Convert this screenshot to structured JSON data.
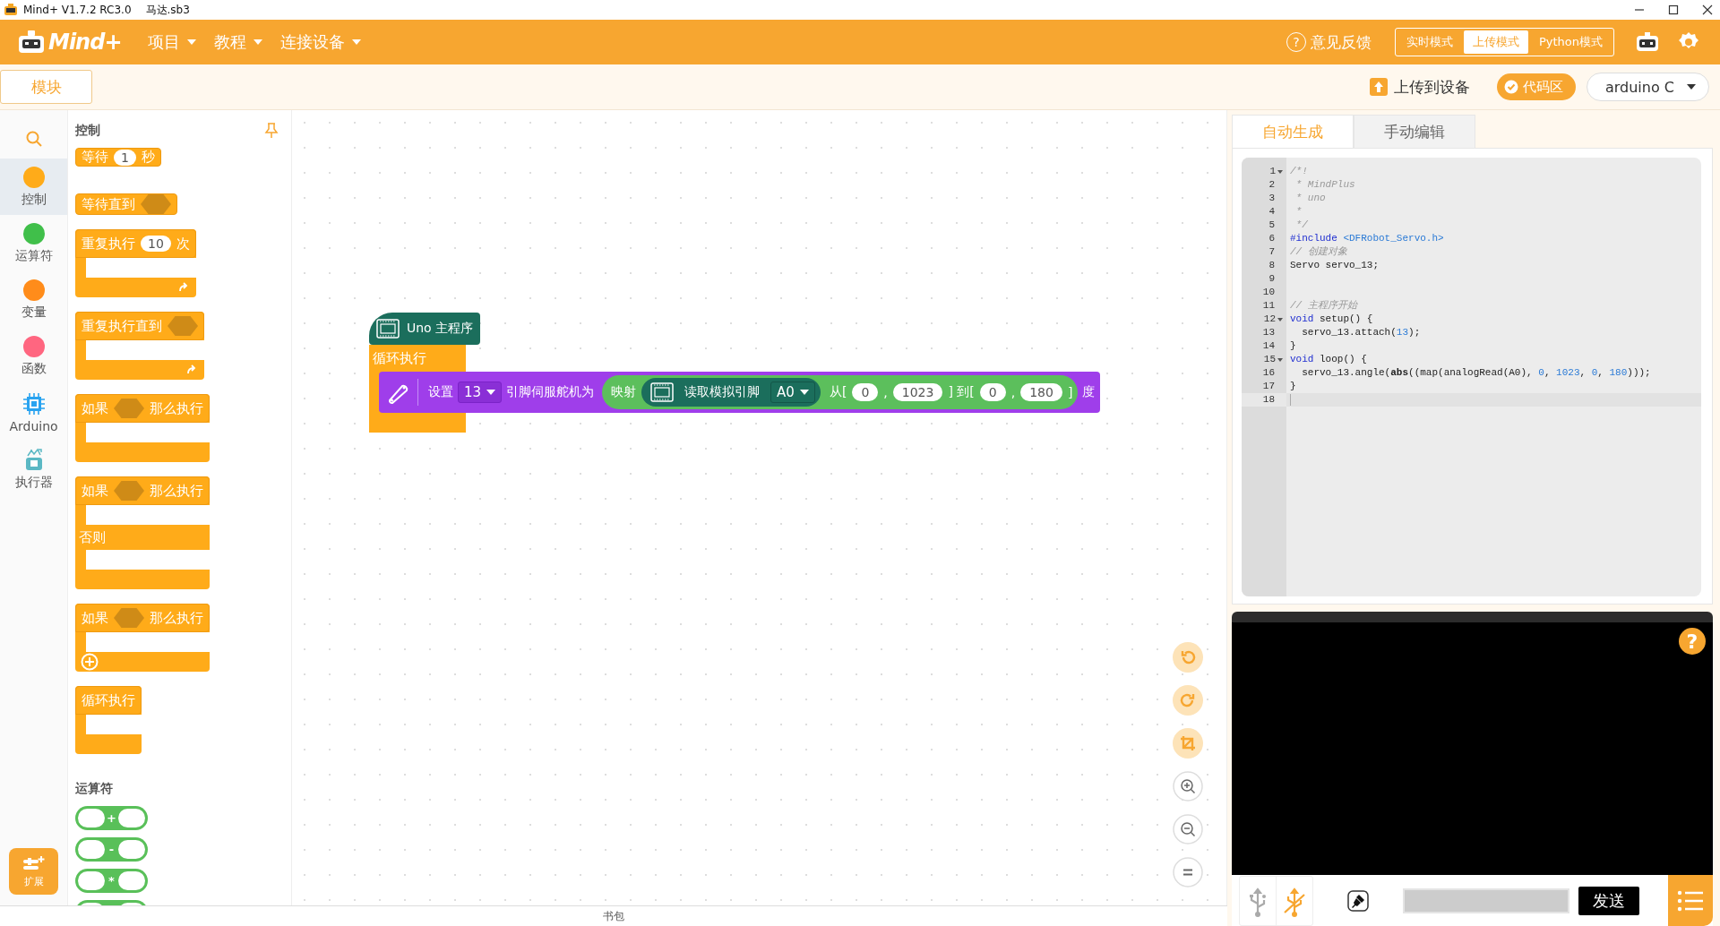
{
  "title_bar": {
    "app": "Mind+ V1.7.2 RC3.0",
    "file": "马达.sb3"
  },
  "menu_bar": {
    "logo": "Mind+",
    "menus": [
      {
        "label": "项目"
      },
      {
        "label": "教程"
      },
      {
        "label": "连接设备"
      }
    ],
    "help_mark": "?",
    "feedback": "意见反馈",
    "modes": [
      {
        "label": "实时模式",
        "selected": false
      },
      {
        "label": "上传模式",
        "selected": true
      },
      {
        "label": "Python模式",
        "selected": false
      }
    ]
  },
  "toolbar": {
    "tab": "模块",
    "upload": "上传到设备",
    "code_toggle": {
      "label": "代码区",
      "on": true
    },
    "language": "arduino C"
  },
  "categories": [
    {
      "label": "控制",
      "kind": "dot",
      "color": "#ffab19",
      "selected": true
    },
    {
      "label": "运算符",
      "kind": "dot",
      "color": "#40bf4a",
      "selected": false
    },
    {
      "label": "变量",
      "kind": "dot",
      "color": "#ff8c1a",
      "selected": false
    },
    {
      "label": "函数",
      "kind": "dot",
      "color": "#ff6680",
      "selected": false
    },
    {
      "label": "Arduino",
      "kind": "chip",
      "selected": false
    },
    {
      "label": "执行器",
      "kind": "actuator",
      "selected": false
    }
  ],
  "extension": "扩展",
  "palette": [
    {
      "heading": "控制",
      "blocks": [
        {
          "kind": "stack",
          "parts": [
            {
              "kind": "text",
              "text": "等待"
            },
            {
              "kind": "number",
              "text": "1"
            },
            {
              "kind": "text",
              "text": "秒"
            }
          ]
        },
        {
          "kind": "stack",
          "parts": [
            {
              "kind": "text",
              "text": "等待直到"
            },
            {
              "kind": "bool"
            }
          ]
        },
        {
          "kind": "loop",
          "parts": [
            {
              "kind": "text",
              "text": "重复执行"
            },
            {
              "kind": "number",
              "text": "10"
            },
            {
              "kind": "text",
              "text": "次"
            }
          ]
        },
        {
          "kind": "loop",
          "parts": [
            {
              "kind": "text",
              "text": "重复执行直到"
            },
            {
              "kind": "bool"
            }
          ]
        },
        {
          "kind": "if",
          "parts": [
            {
              "kind": "text",
              "text": "如果"
            },
            {
              "kind": "bool"
            },
            {
              "kind": "text",
              "text": "那么执行"
            }
          ]
        },
        {
          "kind": "if-else",
          "parts": [
            {
              "kind": "text",
              "text": "如果"
            },
            {
              "kind": "bool"
            },
            {
              "kind": "text",
              "text": "那么执行"
            }
          ],
          "else_label": "否则"
        },
        {
          "kind": "if-plus",
          "parts": [
            {
              "kind": "text",
              "text": "如果"
            },
            {
              "kind": "bool"
            },
            {
              "kind": "text",
              "text": "那么执行"
            }
          ]
        },
        {
          "kind": "forever",
          "parts": [
            {
              "kind": "text",
              "text": "循环执行"
            }
          ]
        }
      ]
    },
    {
      "heading": "运算符",
      "blocks": [
        {
          "kind": "operator",
          "op": "+"
        },
        {
          "kind": "operator",
          "op": "-"
        },
        {
          "kind": "operator",
          "op": "*"
        },
        {
          "kind": "operator"
        }
      ]
    }
  ],
  "script": {
    "hat": "Uno 主程序",
    "loop": "循环执行",
    "statement": [
      {
        "kind": "text",
        "text": "设置"
      },
      {
        "kind": "dropdown",
        "text": "13"
      },
      {
        "kind": "text",
        "text": "引脚伺服舵机为"
      },
      {
        "kind": "map",
        "parts": [
          {
            "kind": "text",
            "text": "映射"
          },
          {
            "kind": "sensor",
            "parts": [
              {
                "kind": "text",
                "text": "读取模拟引脚"
              },
              {
                "kind": "dropdown",
                "text": "A0"
              }
            ]
          },
          {
            "kind": "text",
            "text": "从["
          },
          {
            "kind": "number",
            "text": "0"
          },
          {
            "kind": "text",
            "text": ","
          },
          {
            "kind": "number",
            "text": "1023"
          },
          {
            "kind": "text",
            "text": "] 到["
          },
          {
            "kind": "number",
            "text": "0"
          },
          {
            "kind": "text",
            "text": ","
          },
          {
            "kind": "number",
            "text": "180"
          },
          {
            "kind": "text",
            "text": "]"
          }
        ]
      },
      {
        "kind": "text",
        "text": "度"
      }
    ]
  },
  "code_tabs": [
    {
      "label": "自动生成",
      "selected": true
    },
    {
      "label": "手动编辑",
      "selected": false
    }
  ],
  "code": [
    {
      "number": "1",
      "foldable": true,
      "current": false,
      "tokens": [
        {
          "kind": "comment",
          "text": "/*!"
        }
      ]
    },
    {
      "number": "2",
      "foldable": false,
      "current": false,
      "tokens": [
        {
          "kind": "comment",
          "text": " * MindPlus"
        }
      ]
    },
    {
      "number": "3",
      "foldable": false,
      "current": false,
      "tokens": [
        {
          "kind": "comment",
          "text": " * uno"
        }
      ]
    },
    {
      "number": "4",
      "foldable": false,
      "current": false,
      "tokens": [
        {
          "kind": "comment",
          "text": " *"
        }
      ]
    },
    {
      "number": "5",
      "foldable": false,
      "current": false,
      "tokens": [
        {
          "kind": "comment",
          "text": " */"
        }
      ]
    },
    {
      "number": "6",
      "foldable": false,
      "current": false,
      "tokens": [
        {
          "kind": "keyword",
          "text": "#include"
        },
        {
          "kind": "string",
          "text": " <DFRobot_Servo.h>"
        }
      ]
    },
    {
      "number": "7",
      "foldable": false,
      "current": false,
      "tokens": [
        {
          "kind": "comment",
          "text": "// 创建对象"
        }
      ]
    },
    {
      "number": "8",
      "foldable": false,
      "current": false,
      "tokens": [
        {
          "kind": "plain",
          "text": "Servo servo_13;"
        }
      ]
    },
    {
      "number": "9",
      "foldable": false,
      "current": false
    },
    {
      "number": "10",
      "foldable": false,
      "current": false
    },
    {
      "number": "11",
      "foldable": false,
      "current": false,
      "tokens": [
        {
          "kind": "comment",
          "text": "// 主程序开始"
        }
      ]
    },
    {
      "number": "12",
      "foldable": true,
      "current": false,
      "tokens": [
        {
          "kind": "keyword",
          "text": "void"
        },
        {
          "kind": "plain",
          "text": " setup() {"
        }
      ]
    },
    {
      "number": "13",
      "foldable": false,
      "current": false,
      "tokens": [
        {
          "kind": "plain",
          "text": "  servo_13.attach("
        },
        {
          "kind": "number",
          "text": "13"
        },
        {
          "kind": "plain",
          "text": ");"
        }
      ]
    },
    {
      "number": "14",
      "foldable": false,
      "current": false,
      "tokens": [
        {
          "kind": "plain",
          "text": "}"
        }
      ]
    },
    {
      "number": "15",
      "foldable": true,
      "current": false,
      "tokens": [
        {
          "kind": "keyword",
          "text": "void"
        },
        {
          "kind": "plain",
          "text": " loop() {"
        }
      ]
    },
    {
      "number": "16",
      "foldable": false,
      "current": false,
      "tokens": [
        {
          "kind": "plain",
          "text": "  servo_13.angle("
        },
        {
          "kind": "builtin",
          "text": "abs"
        },
        {
          "kind": "plain",
          "text": "((map(analogRead(A0), "
        },
        {
          "kind": "number",
          "text": "0"
        },
        {
          "kind": "plain",
          "text": ", "
        },
        {
          "kind": "number",
          "text": "1023"
        },
        {
          "kind": "plain",
          "text": ", "
        },
        {
          "kind": "number",
          "text": "0"
        },
        {
          "kind": "plain",
          "text": ", "
        },
        {
          "kind": "number",
          "text": "180"
        },
        {
          "kind": "plain",
          "text": ")));"
        }
      ]
    },
    {
      "number": "17",
      "foldable": false,
      "current": false,
      "tokens": [
        {
          "kind": "plain",
          "text": "}"
        }
      ]
    },
    {
      "number": "18",
      "foldable": false,
      "current": true
    }
  ],
  "serial": {
    "help_mark": "?",
    "send": "发送"
  },
  "backpack": "书包"
}
